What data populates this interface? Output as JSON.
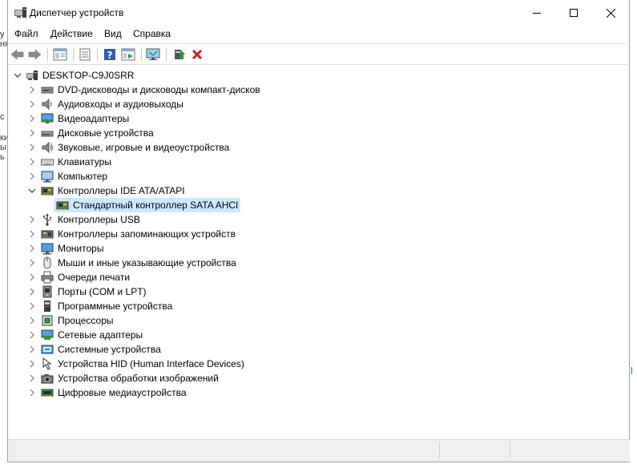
{
  "window": {
    "title": "Диспетчер устройств"
  },
  "menu": {
    "items": [
      "Файл",
      "Действие",
      "Вид",
      "Справка"
    ]
  },
  "toolbar": {
    "buttons": [
      {
        "icon": "back-arrow-icon"
      },
      {
        "icon": "forward-arrow-icon"
      },
      {
        "icon": "properties-icon"
      },
      {
        "icon": "details-icon"
      },
      {
        "icon": "help-icon"
      },
      {
        "icon": "view-icon"
      },
      {
        "icon": "monitor-icon"
      },
      {
        "icon": "update-driver-icon"
      },
      {
        "icon": "uninstall-icon"
      }
    ]
  },
  "colors": {
    "selection": "#cce8ff",
    "uninstall": "#d11d1d",
    "accent": "#1a6ec2"
  },
  "background_window": {
    "fragments": [
      "у",
      "ня",
      "с",
      "ки",
      "ы",
      "ь"
    ]
  },
  "tree": {
    "root": "DESKTOP-C9J0SRR",
    "categories": [
      {
        "label": "DVD-дисководы и дисководы компакт-дисков",
        "icon": "dvd-drive-icon"
      },
      {
        "label": "Аудиовходы и аудиовыходы",
        "icon": "speaker-icon"
      },
      {
        "label": "Видеоадаптеры",
        "icon": "display-adapter-icon"
      },
      {
        "label": "Дисковые устройства",
        "icon": "disk-drive-icon"
      },
      {
        "label": "Звуковые, игровые и видеоустройства",
        "icon": "sound-icon"
      },
      {
        "label": "Клавиатуры",
        "icon": "keyboard-icon"
      },
      {
        "label": "Компьютер",
        "icon": "computer-icon"
      },
      {
        "label": "Контроллеры IDE ATA/ATAPI",
        "icon": "ide-controller-icon",
        "expanded": true,
        "children": [
          {
            "label": "Стандартный контроллер SATA AHCI",
            "icon": "ide-controller-icon",
            "selected": true
          }
        ]
      },
      {
        "label": "Контроллеры USB",
        "icon": "usb-icon"
      },
      {
        "label": "Контроллеры запоминающих устройств",
        "icon": "storage-controller-icon"
      },
      {
        "label": "Мониторы",
        "icon": "monitor-icon"
      },
      {
        "label": "Мыши и иные указывающие устройства",
        "icon": "mouse-icon"
      },
      {
        "label": "Очереди печати",
        "icon": "printer-icon"
      },
      {
        "label": "Порты (COM и LPT)",
        "icon": "port-icon"
      },
      {
        "label": "Программные устройства",
        "icon": "software-device-icon"
      },
      {
        "label": "Процессоры",
        "icon": "processor-icon"
      },
      {
        "label": "Сетевые адаптеры",
        "icon": "network-adapter-icon"
      },
      {
        "label": "Системные устройства",
        "icon": "system-device-icon"
      },
      {
        "label": "Устройства HID (Human Interface Devices)",
        "icon": "hid-icon"
      },
      {
        "label": "Устройства обработки изображений",
        "icon": "imaging-device-icon"
      },
      {
        "label": "Цифровые медиаустройства",
        "icon": "media-device-icon"
      }
    ]
  }
}
